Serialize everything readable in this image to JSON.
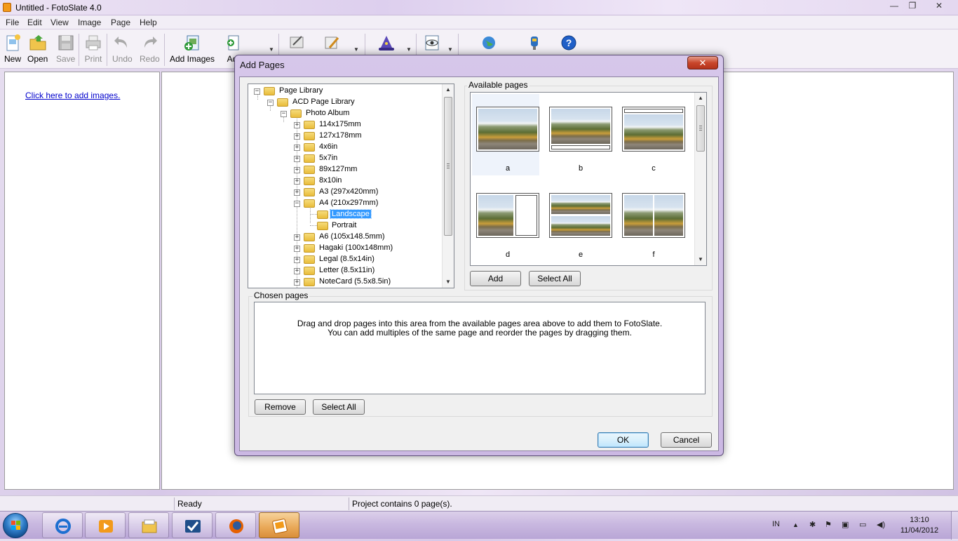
{
  "window": {
    "title": "Untitled - FotoSlate 4.0",
    "minimize": "—",
    "restore": "❐",
    "close": "✕"
  },
  "menu": [
    "File",
    "Edit",
    "View",
    "Image",
    "Page",
    "Help"
  ],
  "toolbar": {
    "new": "New",
    "open": "Open",
    "save": "Save",
    "print": "Print",
    "undo": "Undo",
    "redo": "Redo",
    "add_images": "Add Images",
    "add_pages_partial": "Ad"
  },
  "left_pane": {
    "link": "Click here to add images."
  },
  "status": {
    "ready": "Ready",
    "project": "Project contains 0 page(s)."
  },
  "dialog": {
    "title": "Add Pages",
    "close": "✕",
    "tree": {
      "root": "Page Library",
      "library": "ACD Page Library",
      "album": "Photo Album",
      "sizes": [
        "114x175mm",
        "127x178mm",
        "4x6in",
        "5x7in",
        "89x127mm",
        "8x10in",
        "A3 (297x420mm)",
        "A4 (210x297mm)",
        "A6 (105x148.5mm)",
        "Hagaki (100x148mm)",
        "Legal (8.5x14in)",
        "Letter (8.5x11in)",
        "NoteCard (5.5x8.5in)"
      ],
      "a4_children": [
        "Landscape",
        "Portrait"
      ],
      "selected": "Landscape"
    },
    "available_label": "Available pages",
    "thumbnails": [
      "a",
      "b",
      "c",
      "d",
      "e",
      "f"
    ],
    "add_button": "Add",
    "select_all_button": "Select All",
    "chosen_label": "Chosen pages",
    "chosen_hint_1": "Drag and drop pages into this area from the available pages area above to add them to FotoSlate.",
    "chosen_hint_2": "You can add multiples of the same page and reorder the pages by dragging them.",
    "remove_button": "Remove",
    "chosen_select_all_button": "Select All",
    "ok_button": "OK",
    "cancel_button": "Cancel"
  },
  "taskbar": {
    "language": "IN",
    "time": "13:10",
    "date": "11/04/2012"
  },
  "colors": {
    "selection": "#3399ff",
    "link": "#0000cc",
    "taskbar_active": "#e9a857"
  }
}
